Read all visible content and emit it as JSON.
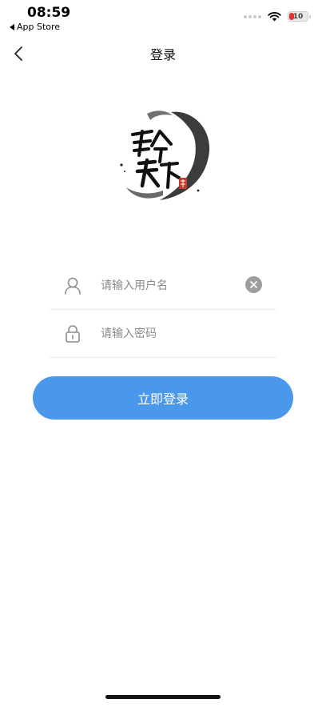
{
  "status_bar": {
    "time": "08:59",
    "back_app": "App Store",
    "battery": "10"
  },
  "nav": {
    "title": "登录",
    "back_icon": "chevron-left-icon"
  },
  "logo": {
    "text": "号令天下",
    "seal": "印",
    "icon": "calligraphy-logo"
  },
  "form": {
    "username": {
      "value": "",
      "placeholder": "请输入用户名",
      "icon": "user-icon",
      "clear_icon": "clear-icon"
    },
    "password": {
      "value": "",
      "placeholder": "请输入密码",
      "icon": "lock-icon"
    }
  },
  "login_button": {
    "label": "立即登录"
  },
  "colors": {
    "accent": "#4a98ec",
    "clear": "#9e9e9e",
    "icon": "#8c8c8c"
  }
}
